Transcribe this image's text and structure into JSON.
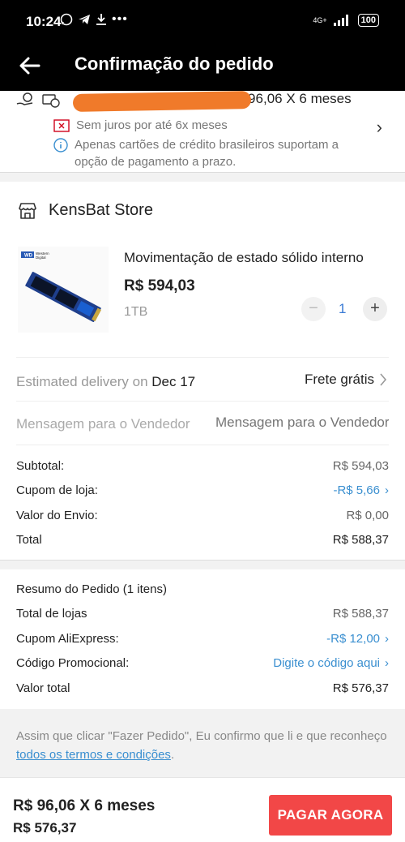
{
  "status_bar": {
    "time": "10:24",
    "network": "4G+",
    "battery": "100"
  },
  "header": {
    "title": "Confirmação do pedido"
  },
  "payment": {
    "installment_partial": "S 96,06 X 6 meses",
    "no_interest": "Sem juros por até 6x meses",
    "info": "Apenas cartões de crédito brasileiros suportam a opção de pagamento a prazo."
  },
  "store": {
    "name": "KensBat Store",
    "product": {
      "name": "Movimentação de estado sólido interno",
      "price": "R$ 594,03",
      "variant": "1TB",
      "quantity": "1",
      "brand": "WD Western Digital"
    },
    "delivery": {
      "label": "Estimated delivery on",
      "date": "Dec 17",
      "shipping": "Frete grátis"
    },
    "message": {
      "label": "Mensagem para o Vendedor",
      "placeholder": "Mensagem para o Vendedor"
    },
    "summary": {
      "subtotal_label": "Subtotal:",
      "subtotal_value": "R$ 594,03",
      "coupon_label": "Cupom de loja:",
      "coupon_value": "-R$ 5,66",
      "shipping_label": "Valor do Envio:",
      "shipping_value": "R$ 0,00",
      "total_label": "Total",
      "total_value": "R$ 588,37"
    }
  },
  "order_summary": {
    "title": "Resumo do Pedido (1 itens)",
    "stores_total_label": "Total de lojas",
    "stores_total_value": "R$ 588,37",
    "ali_coupon_label": "Cupom AliExpress:",
    "ali_coupon_value": "-R$ 12,00",
    "promo_label": "Código Promocional:",
    "promo_value": "Digite o código aqui",
    "grand_total_label": "Valor total",
    "grand_total_value": "R$ 576,37"
  },
  "terms": {
    "text": "Assim que clicar \"Fazer Pedido\", Eu confirmo que li e que reconheço",
    "link": "todos os termos e condições",
    "end": "."
  },
  "bottom_bar": {
    "installment": "R$ 96,06 X 6 meses",
    "total": "R$ 576,37",
    "pay_button": "PAGAR AGORA"
  },
  "colors": {
    "accent_red": "#f24747",
    "link_blue": "#3a8fd0",
    "redaction_orange": "#f07a2a"
  }
}
